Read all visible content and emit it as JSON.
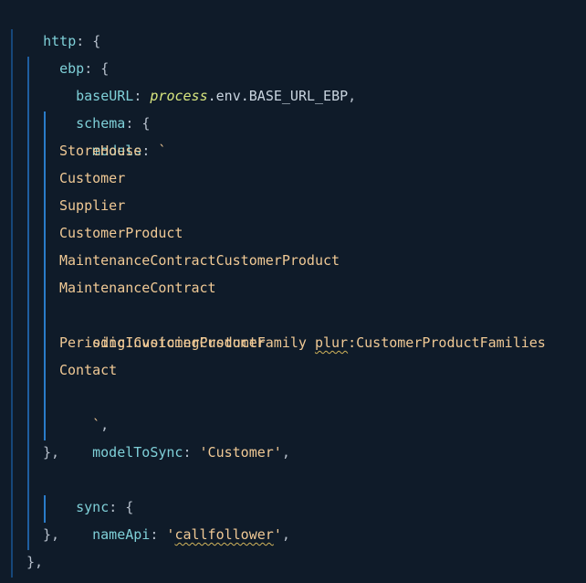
{
  "code": {
    "http_key": "http",
    "ebp_key": "ebp",
    "baseurl_key": "baseURL",
    "process_word": "process",
    "env_word": ".env.BASE_URL_EBP",
    "schema_key": "schema",
    "models_key": "models",
    "models_open": "`",
    "models_lines": [
      "StoreHouse",
      "Customer",
      "Supplier",
      "CustomerProduct",
      "MaintenanceContractCustomerProduct",
      "MaintenanceContract"
    ],
    "sing_prefix": "sing:",
    "sing_value": "CustomerProductFamily",
    "plur_word": "plur",
    "plur_value": ":CustomerProductFamilies",
    "models_lines_after": [
      "PeriodicInvoicingCustomer",
      "Contact"
    ],
    "models_close": "`",
    "modeltosync_key": "modelToSync",
    "modeltosync_value": "'Customer'",
    "sync_key": "sync",
    "nameapi_key": "nameApi",
    "nameapi_value_quote_open": "'",
    "nameapi_value": "callfollower",
    "nameapi_value_quote_close": "'"
  },
  "colors": {
    "background": "#0f1b29",
    "key": "#7fd0d8",
    "string": "#f0c995",
    "italic_identifier": "#d8e67f",
    "spellcheck_squiggle": "#d2b45b"
  }
}
